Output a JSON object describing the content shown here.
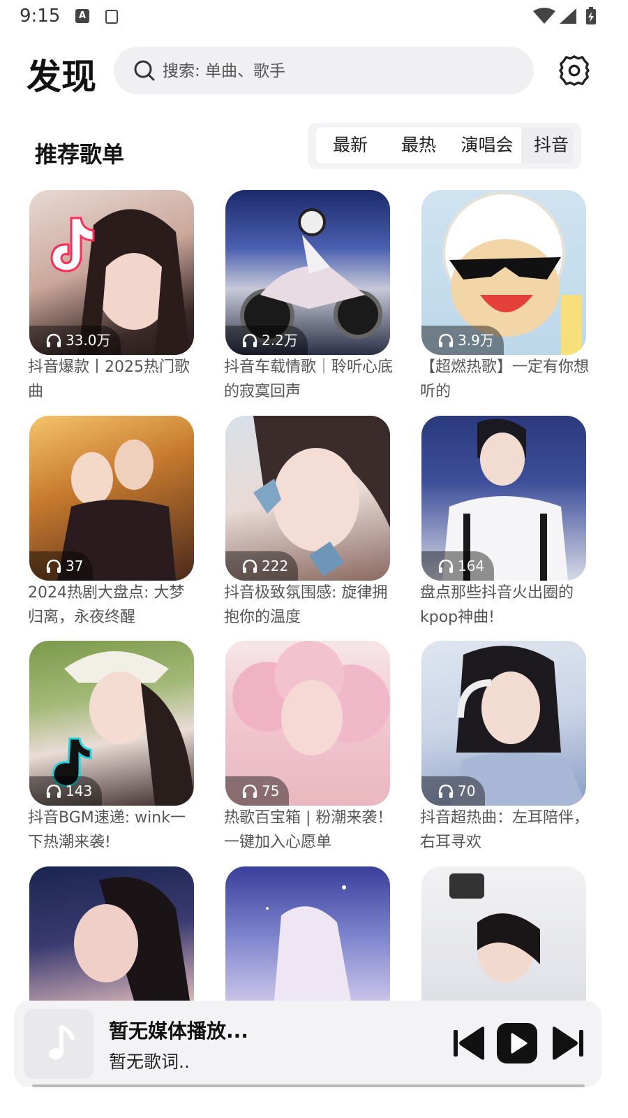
{
  "status_bar": {
    "time": "9:15",
    "icons": [
      "text-a-icon",
      "square-icon",
      "wifi-icon",
      "signal-icon",
      "battery-icon"
    ]
  },
  "header": {
    "title": "发现",
    "search_placeholder": "搜索: 单曲、歌手",
    "settings_icon": "gear-icon"
  },
  "section": {
    "title": "推荐歌单",
    "tabs": [
      {
        "label": "最新",
        "active": false
      },
      {
        "label": "最热",
        "active": false
      },
      {
        "label": "演唱会",
        "active": false
      },
      {
        "label": "抖音",
        "active": true
      }
    ]
  },
  "playlists": [
    {
      "plays": "33.0万",
      "caption": "抖音爆款丨2025热门歌曲"
    },
    {
      "plays": "2.2万",
      "caption": "抖音车载情歌｜聆听心底的寂寞回声"
    },
    {
      "plays": "3.9万",
      "caption": "【超燃热歌】一定有你想听的"
    },
    {
      "plays": "37",
      "caption": "2024热剧大盘点: 大梦归离，永夜终醒"
    },
    {
      "plays": "222",
      "caption": "抖音极致氛围感: 旋律拥抱你的温度"
    },
    {
      "plays": "164",
      "caption": "盘点那些抖音火出圈的kpop神曲!"
    },
    {
      "plays": "143",
      "caption": "抖音BGM速递: wink一下热潮来袭!"
    },
    {
      "plays": "75",
      "caption": "热歌百宝箱 | 粉潮来袭！一键加入心愿单"
    },
    {
      "plays": "70",
      "caption": "抖音超热曲：左耳陪伴，右耳寻欢"
    },
    {
      "plays": "",
      "caption": ""
    },
    {
      "plays": "",
      "caption": ""
    },
    {
      "plays": "",
      "caption": ""
    }
  ],
  "player": {
    "title": "暂无媒体播放...",
    "lyric": "暂无歌词..",
    "controls": [
      "previous-icon",
      "play-icon",
      "next-icon"
    ]
  },
  "colors": {
    "background": "#ffffff",
    "search_bg": "#f0f0f2",
    "player_bg": "#f3f3f5",
    "caption": "#555555"
  }
}
